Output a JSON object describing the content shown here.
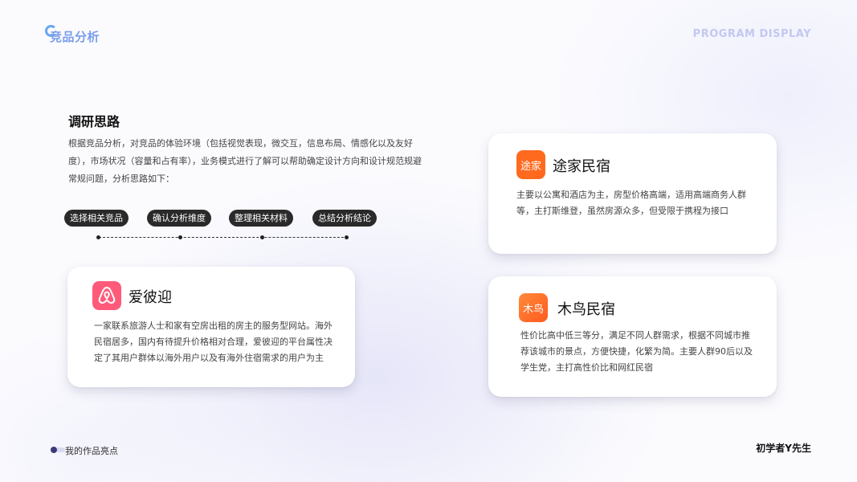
{
  "header": {
    "logo_text": "竞品分析",
    "program_label": "PROGRAM DISPLAY"
  },
  "research": {
    "title": "调研思路",
    "intro": "根据竞品分析，对竞品的体验环境（包括视觉表现，微交互，信息布局、情感化以及友好度），市场状况（容量和占有率），业务模式进行了解可以帮助确定设计方向和设计规范规避常规问题，分析思路如下："
  },
  "steps": [
    {
      "label": "选择相关竞品"
    },
    {
      "label": "确认分析维度"
    },
    {
      "label": "整理相关材料"
    },
    {
      "label": "总结分析结论"
    }
  ],
  "cards": {
    "airbnb": {
      "name": "爱彼迎",
      "desc": "一家联系旅游人士和家有空房出租的房主的服务型网站。海外民宿居多，国内有待提升价格相对合理，爱彼迎的平台属性决定了其用户群体以海外用户以及有海外住宿需求的用户为主",
      "icon": "airbnb-logo-icon",
      "color": "#ff5a7a"
    },
    "tujia": {
      "name": "途家民宿",
      "desc": "主要以公寓和酒店为主，房型价格高端，适用高端商务人群等，主打斯维登，虽然房源众多，但受限于携程为接口",
      "logo_text": "途家",
      "color": "#ff6a1f"
    },
    "muniao": {
      "name": "木鸟民宿",
      "desc": "性价比高中低三等分，满足不同人群需求，根据不同城市推荐该城市的景点，方便快捷，化繁为简。主要人群90后以及学生党，主打高性价比和网红民宿",
      "logo_text": "木鸟",
      "color": "#ff6a2a"
    }
  },
  "footer": {
    "caption": "我的作品亮点",
    "author": "初学者Y先生"
  }
}
